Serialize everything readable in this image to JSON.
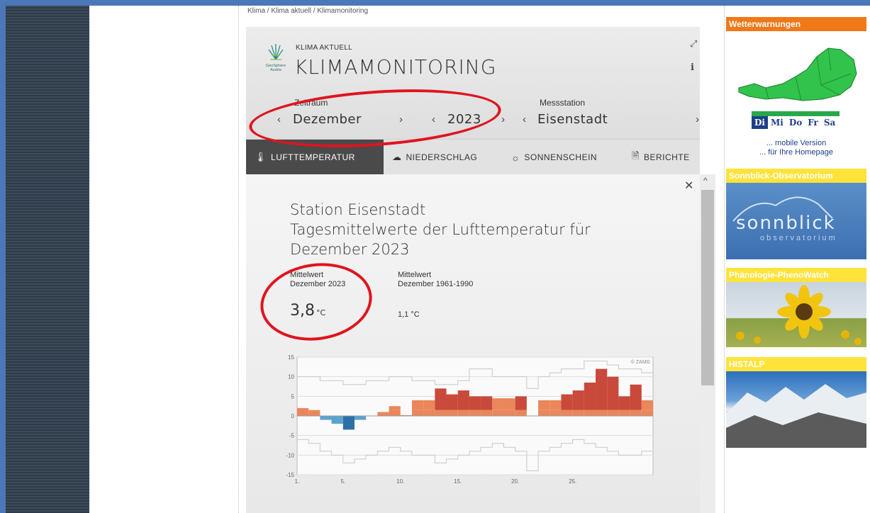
{
  "breadcrumb": "Klima / Klima aktuell / Klimamonitoring",
  "header": {
    "subtitle": "KLIMA AKTUELL",
    "title": "KLIMAMONITORING",
    "logo_text": "GeoSphere Austria"
  },
  "selectors": {
    "zeitraum_label": "Zeitraum",
    "month": "Dezember",
    "year": "2023",
    "messstation_label": "Messstation",
    "station": "Eisenstadt"
  },
  "tabs": [
    {
      "label": "LUFTTEMPERATUR",
      "icon": "thermometer-icon"
    },
    {
      "label": "NIEDERSCHLAG",
      "icon": "rain-cloud-icon"
    },
    {
      "label": "SONNENSCHEIN",
      "icon": "sun-icon"
    },
    {
      "label": "BERICHTE",
      "icon": "document-icon"
    }
  ],
  "panel": {
    "line1": "Station Eisenstadt",
    "line2": "Tagesmittelwerte der Lufttemperatur für",
    "line3": "Dezember 2023",
    "mean_label_1a": "Mittelwert",
    "mean_label_1b": "Dezember 2023",
    "mean_value": "3,8",
    "mean_unit": "°C",
    "mean_label_2a": "Mittelwert",
    "mean_label_2b": "Dezember 1961-1990",
    "ref_value": "1,1 °C"
  },
  "chart_data": {
    "type": "bar",
    "x": [
      1,
      2,
      3,
      4,
      5,
      6,
      7,
      8,
      9,
      10,
      11,
      12,
      13,
      14,
      15,
      16,
      17,
      18,
      19,
      20,
      21,
      22,
      23,
      24,
      25,
      26,
      27,
      28,
      29,
      30,
      31
    ],
    "xticks": [
      "1.",
      "5.",
      "10.",
      "15.",
      "20.",
      "25."
    ],
    "yticks": [
      "15",
      "10",
      "5",
      "0",
      "-5",
      "-10",
      "-15"
    ],
    "ylim": [
      -15,
      15
    ],
    "series": [
      {
        "name": "",
        "values": [
          2,
          1.5,
          -1,
          -2,
          -3.5,
          -1,
          0,
          1,
          2.5,
          0.2,
          4,
          4,
          7,
          5.5,
          6.5,
          5,
          5,
          4.5,
          4.5,
          5,
          0,
          4,
          4,
          5.5,
          6.5,
          8.5,
          12,
          10,
          5,
          8,
          4
        ]
      }
    ],
    "reference": [
      2.5,
      2.5,
      2,
      2,
      1.5,
      1.5,
      1.5,
      1.5,
      1.5,
      1.5,
      1.5,
      1.5,
      1.5,
      1.5,
      1.5,
      1.5,
      1.5,
      1.5,
      1.5,
      1.5,
      0,
      1.5,
      1.5,
      1.5,
      1.5,
      1.5,
      1.5,
      1.5,
      1.5,
      1.5,
      1.5
    ],
    "watermark": "© ZAMG",
    "colors": {
      "warm": "#e9875b",
      "warm_dark": "#c9493a",
      "cold": "#5aa3cf",
      "cold_dark": "#2f6fa7"
    }
  },
  "sidebar": {
    "warnings": {
      "title": "Wetterwarnungen",
      "days": [
        "Di",
        "Mi",
        "Do",
        "Fr",
        "Sa"
      ],
      "link1": "... mobile Version",
      "link2": "... für Ihre Homepage"
    },
    "sonnblick": {
      "title": "Sonnblick-Observatorium",
      "logo": "sonnblick",
      "logo_sub": "observatorium"
    },
    "pheno": {
      "title": "Phänologie-PhenoWatch"
    },
    "histalp": {
      "title": "HISTALP"
    }
  }
}
